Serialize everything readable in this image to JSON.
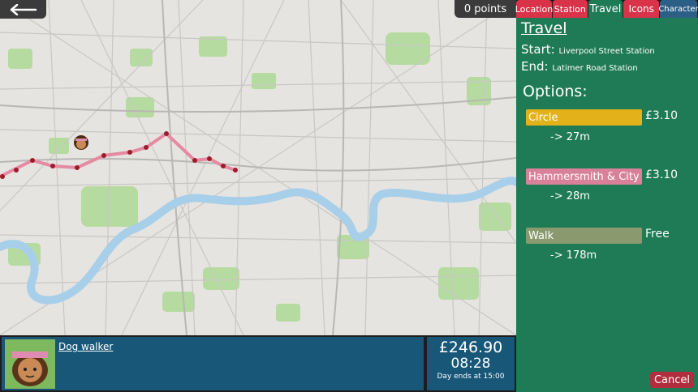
{
  "header": {
    "points": "0 points"
  },
  "tabs": [
    {
      "label": "Location",
      "color": "#d9334a"
    },
    {
      "label": "Station",
      "color": "#d9334a"
    },
    {
      "label": "Travel",
      "color": "#1e7b56",
      "active": true
    },
    {
      "label": "Icons",
      "color": "#d9334a"
    },
    {
      "label": "Character",
      "color": "#2c5f86"
    }
  ],
  "travel": {
    "title": "Travel",
    "start_label": "Start:",
    "start_value": "Liverpool Street Station",
    "end_label": "End:",
    "end_value": "Latimer Road Station",
    "options_title": "Options:",
    "options": [
      {
        "name": "Circle",
        "price": "£3.10",
        "time": "-> 27m",
        "color": "#e3b11a"
      },
      {
        "name": "Hammersmith & City",
        "price": "£3.10",
        "time": "-> 28m",
        "color": "#d9809b"
      },
      {
        "name": "Walk",
        "price": "Free",
        "time": "-> 178m",
        "color": "#8a9a6e"
      }
    ],
    "cancel_label": "Cancel"
  },
  "character": {
    "name": "Dog walker"
  },
  "status": {
    "money": "£246.90",
    "time": "08:28",
    "day_end": "Day ends at 15:00"
  },
  "map": {
    "icons": [
      "back-arrow-icon",
      "player-marker-icon",
      "station-marker-icon"
    ],
    "colors": {
      "river": "#a8cfe9",
      "park": "#b5dba0",
      "land": "#e6e4e0",
      "route": "#e58aa1"
    }
  }
}
